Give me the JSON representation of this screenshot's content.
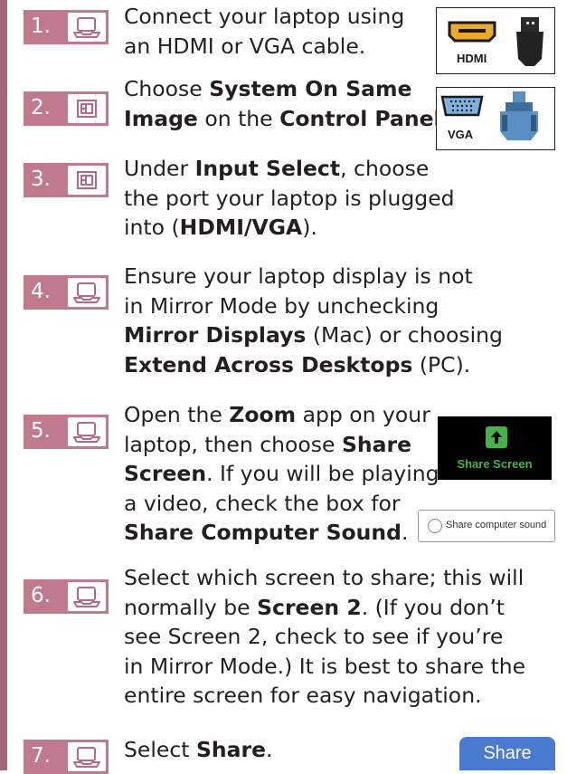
{
  "steps": [
    {
      "number": "1.",
      "icon": "laptop-icon",
      "lines": [
        "Connect your laptop using",
        "an HDMI or VGA cable."
      ]
    },
    {
      "number": "2.",
      "icon": "control-panel-icon",
      "parts": [
        "Choose ",
        "System On Same",
        "Image",
        " on the ",
        "Control Panel",
        "."
      ]
    },
    {
      "number": "3.",
      "icon": "control-panel-icon",
      "parts": [
        "Under ",
        "Input Select",
        ", choose",
        "the port your laptop is plugged",
        "into (",
        "HDMI/VGA",
        ")."
      ]
    },
    {
      "number": "4.",
      "icon": "laptop-icon",
      "parts": [
        "Ensure your laptop display is not",
        "in Mirror Mode by unchecking",
        "Mirror Displays",
        " (Mac) or choosing",
        "Extend Across Desktops",
        " (PC)."
      ]
    },
    {
      "number": "5.",
      "icon": "laptop-icon",
      "parts": [
        "Open the ",
        "Zoom",
        " app on your",
        "laptop, then choose ",
        "Share",
        "Screen",
        ". If you will be playing",
        "a video, check the box for",
        "Share Computer Sound",
        "."
      ]
    },
    {
      "number": "6.",
      "icon": "laptop-icon",
      "parts": [
        "Select which screen to share; this will",
        "normally be ",
        "Screen 2",
        ". (If you don’t",
        "see Screen 2, check to see if you’re",
        "in Mirror Mode.) It is best to share the",
        "entire screen for easy navigation."
      ]
    },
    {
      "number": "7.",
      "icon": "laptop-icon",
      "parts": [
        "Select ",
        "Share",
        "."
      ]
    }
  ],
  "images": {
    "hdmi_label": "HDMI",
    "vga_label": "VGA",
    "zoom_share_screen_label": "Share Screen",
    "share_computer_sound_label": "Share computer sound",
    "share_button_label": "Share"
  },
  "colors": {
    "badge": "#bf7a8e",
    "side_bar": "#a5637c",
    "zoom_green": "#46b34a",
    "share_blue": "#4a7bd0"
  }
}
